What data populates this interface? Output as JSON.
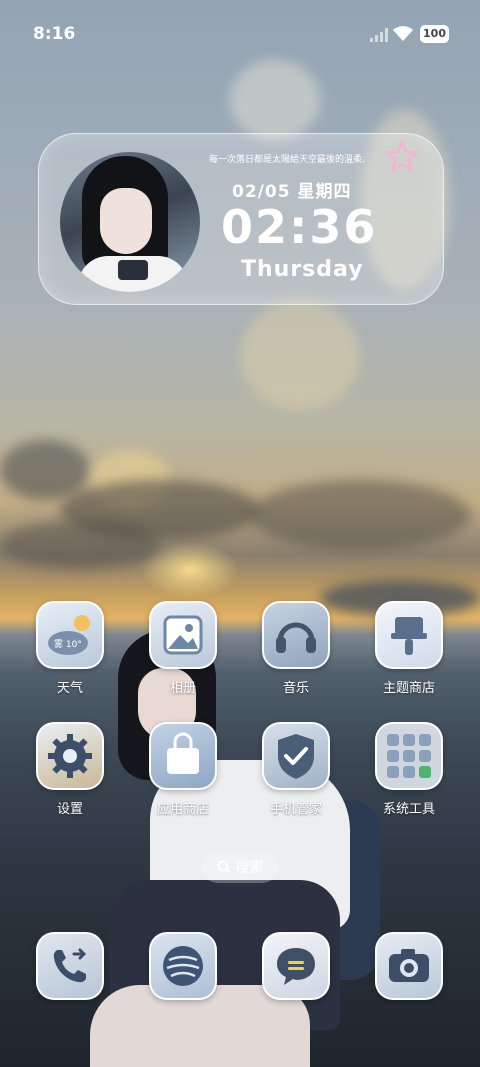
{
  "status_bar": {
    "time": "8:16",
    "battery": "100",
    "icons": [
      "signal-icon",
      "wifi-icon",
      "battery-icon"
    ]
  },
  "widget": {
    "quote": "每一次落日都是太陽給天空最後的溫柔.",
    "date": "02/05  星期四",
    "clock": "02:36",
    "weekday": "Thursday",
    "icons": [
      "avatar-photo",
      "star-icon"
    ]
  },
  "apps": {
    "row1": [
      {
        "label": "天气",
        "icon": "weather-icon",
        "badge": "雾 10°"
      },
      {
        "label": "相册",
        "icon": "gallery-icon"
      },
      {
        "label": "音乐",
        "icon": "headphones-icon"
      },
      {
        "label": "主题商店",
        "icon": "paintbrush-icon"
      }
    ],
    "row2": [
      {
        "label": "设置",
        "icon": "gear-icon"
      },
      {
        "label": "应用商店",
        "icon": "shopping-bag-icon"
      },
      {
        "label": "手机管家",
        "icon": "shield-check-icon"
      },
      {
        "label": "系统工具",
        "icon": "folder-icon"
      }
    ]
  },
  "search": {
    "label": "搜索",
    "icon": "search-icon"
  },
  "dock": [
    {
      "icon": "phone-icon",
      "name": "phone"
    },
    {
      "icon": "browser-icon",
      "name": "browser"
    },
    {
      "icon": "messages-icon",
      "name": "messages"
    },
    {
      "icon": "camera-icon",
      "name": "camera"
    }
  ],
  "colors": {
    "icon_tile_top": "#e8eef6",
    "icon_tile_bottom": "#b9c8da",
    "icon_glyph": "#6f87a6",
    "widget_star": "#f2a7c8"
  }
}
